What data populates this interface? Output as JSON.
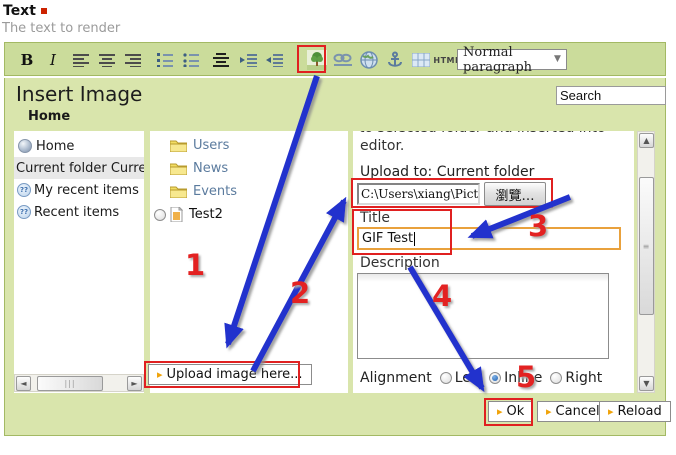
{
  "page": {
    "field_label": "Text",
    "field_hint": "The text to render"
  },
  "toolbar": {
    "bold_label": "B",
    "italic_label": "I",
    "html_label": "HTML",
    "paragraph_style": "Normal paragraph",
    "icons": [
      "bold",
      "italic",
      "align-left",
      "align-center",
      "align-right",
      "ordered-list",
      "unordered-list",
      "justify-center",
      "indent",
      "outdent",
      "insert-image",
      "insert-link",
      "globe",
      "anchor",
      "table",
      "html",
      "paragraph-style"
    ]
  },
  "dialog": {
    "title": "Insert Image",
    "search_value": "Search",
    "breadcrumb": "Home",
    "tree": {
      "items": [
        {
          "label": "Home",
          "icon": "sphere"
        },
        {
          "label": "Current folder",
          "value": "Curren",
          "selected": true
        },
        {
          "label": "My recent items",
          "icon": "recent"
        },
        {
          "label": "Recent items",
          "icon": "recent"
        }
      ]
    },
    "folders": {
      "items": [
        {
          "label": "Users",
          "icon": "folder"
        },
        {
          "label": "News",
          "icon": "folder"
        },
        {
          "label": "Events",
          "icon": "folder"
        },
        {
          "label": "Test2",
          "icon": "file",
          "has_radio": true
        }
      ],
      "upload_label": "Upload image here..."
    },
    "form": {
      "intro_clipped": "to selected folder and inserted into the",
      "intro_line2": "editor.",
      "upload_to_label": "Upload to: Current folder",
      "file_path": "C:\\Users\\xiang\\Pictures\\log",
      "browse_label": "瀏覽…",
      "title_label": "Title",
      "title_value": "GIF Test",
      "description_label": "Description",
      "alignment_label": "Alignment",
      "alignment_options": [
        {
          "label": "Left",
          "checked": false
        },
        {
          "label": "Inline",
          "checked": true
        },
        {
          "label": "Right",
          "checked": false
        }
      ]
    },
    "buttons": [
      {
        "label": "Ok"
      },
      {
        "label": "Cancel"
      },
      {
        "label": "Reload"
      }
    ]
  },
  "annotations": {
    "numbers": [
      "1",
      "2",
      "3",
      "4",
      "5"
    ],
    "arrow_color": "#2431cd",
    "highlight_color": "#e02020"
  }
}
